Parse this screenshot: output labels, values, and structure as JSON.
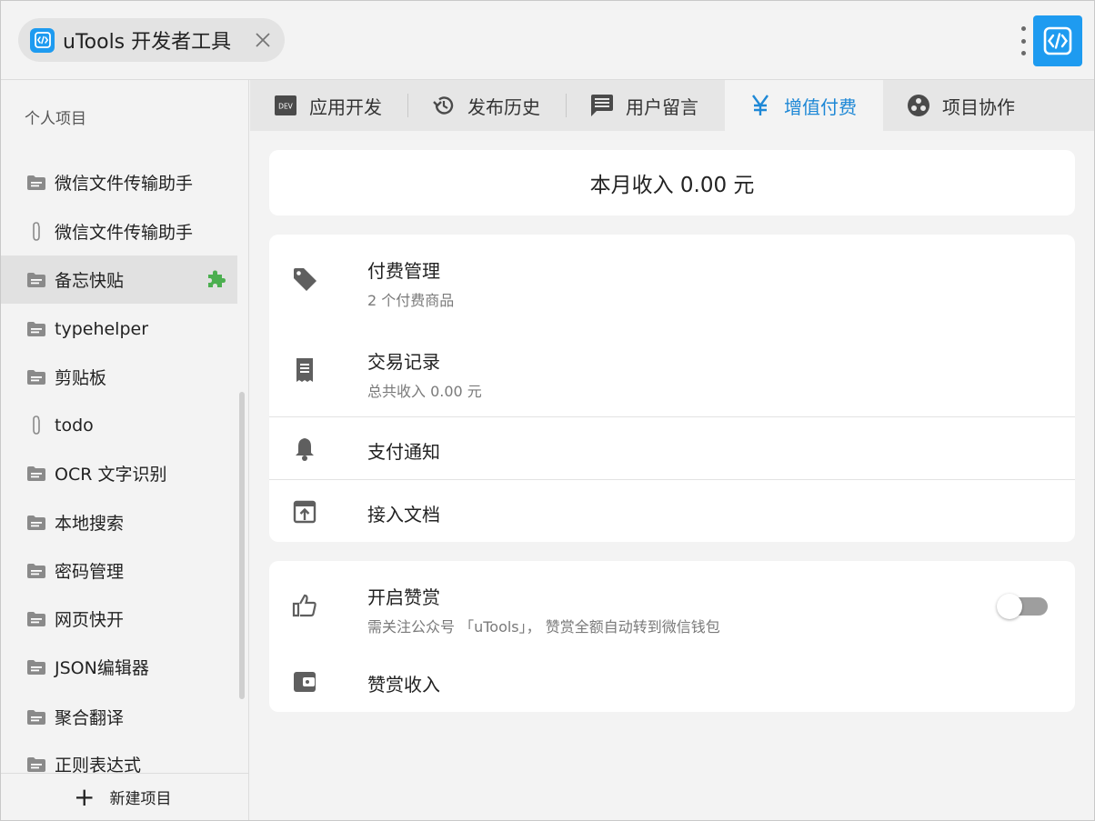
{
  "window": {
    "tab_title": "uTools 开发者工具"
  },
  "sidebar": {
    "heading": "个人项目",
    "items": [
      {
        "label": "微信文件传输助手",
        "icon": "folder-icon"
      },
      {
        "label": "微信文件传输助手",
        "icon": "paperclip-icon"
      },
      {
        "label": "备忘快贴",
        "icon": "folder-icon",
        "active": true,
        "badge": "plugin-icon"
      },
      {
        "label": "typehelper",
        "icon": "folder-icon"
      },
      {
        "label": "剪贴板",
        "icon": "folder-icon"
      },
      {
        "label": "todo",
        "icon": "paperclip-icon"
      },
      {
        "label": "OCR 文字识别",
        "icon": "folder-icon"
      },
      {
        "label": "本地搜索",
        "icon": "folder-icon"
      },
      {
        "label": "密码管理",
        "icon": "folder-icon"
      },
      {
        "label": "网页快开",
        "icon": "folder-icon"
      },
      {
        "label": "JSON编辑器",
        "icon": "folder-icon"
      },
      {
        "label": "聚合翻译",
        "icon": "folder-icon"
      },
      {
        "label": "正则表达式",
        "icon": "folder-icon"
      }
    ],
    "new_project_label": "新建项目"
  },
  "tabs": [
    {
      "label": "应用开发",
      "icon": "dev-icon"
    },
    {
      "label": "发布历史",
      "icon": "history-icon"
    },
    {
      "label": "用户留言",
      "icon": "comment-icon"
    },
    {
      "label": "增值付费",
      "icon": "yen-icon",
      "active": true
    },
    {
      "label": "项目协作",
      "icon": "group-icon"
    }
  ],
  "income": {
    "label": "本月收入 0.00 元"
  },
  "payment_rows": [
    {
      "title": "付费管理",
      "subtitle": "2 个付费商品",
      "icon": "tag-icon"
    },
    {
      "title": "交易记录",
      "subtitle": "总共收入 0.00 元",
      "icon": "receipt-icon"
    },
    {
      "title": "支付通知",
      "subtitle": "",
      "icon": "bell-icon"
    },
    {
      "title": "接入文档",
      "subtitle": "",
      "icon": "open-in-icon"
    }
  ],
  "reward_rows": [
    {
      "title": "开启赞赏",
      "subtitle": "需关注公众号 「uTools」， 赞赏全额自动转到微信钱包",
      "icon": "thumb-up-icon",
      "toggle_on": false
    },
    {
      "title": "赞赏收入",
      "subtitle": "",
      "icon": "wallet-icon"
    }
  ],
  "colors": {
    "accent": "#1e88d6",
    "logo": "#1e9bf0",
    "plugin_badge": "#4caf50"
  }
}
